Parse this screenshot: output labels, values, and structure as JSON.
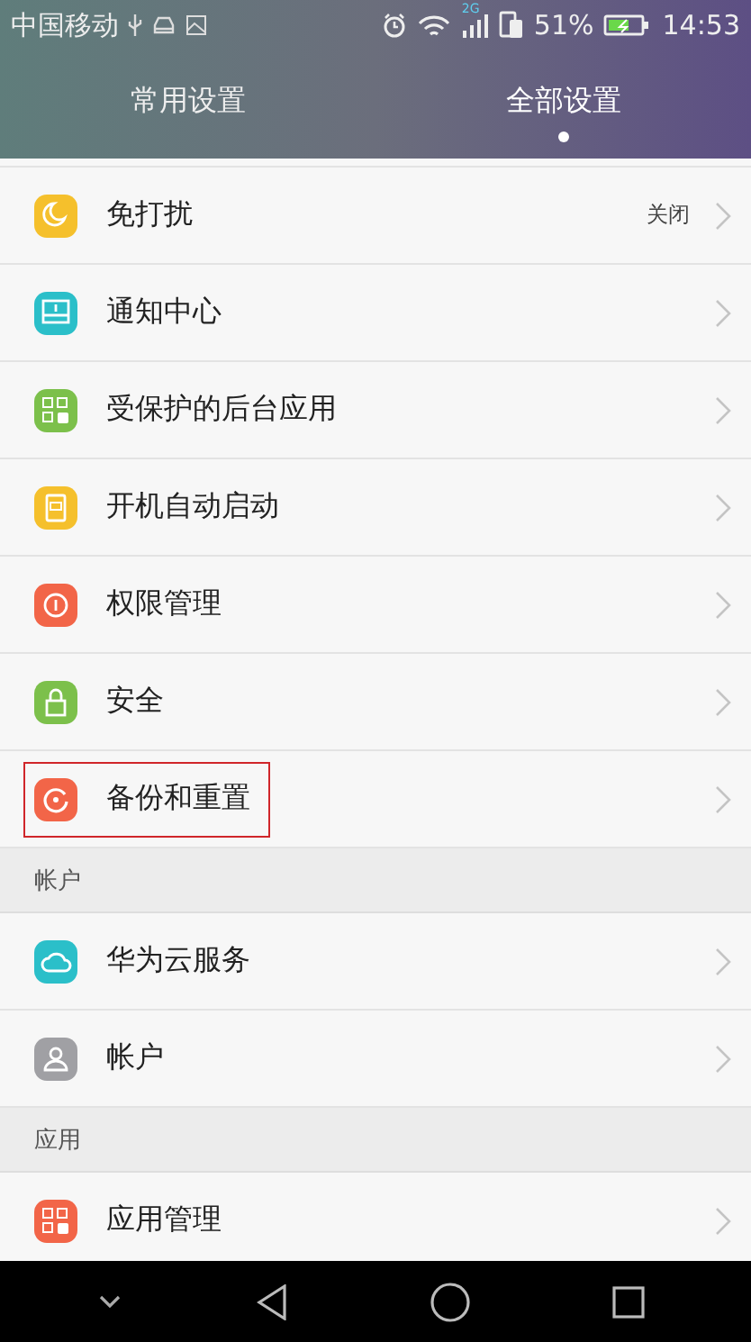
{
  "status_bar": {
    "carrier": "中国移动",
    "network_type": "2G",
    "battery_percent": "51%",
    "time": "14:53"
  },
  "tabs": [
    {
      "label": "常用设置",
      "selected": false
    },
    {
      "label": "全部设置",
      "selected": true
    }
  ],
  "sections": [
    {
      "items": [
        {
          "color": "#f5c02c",
          "label": "免打扰",
          "value": "关闭",
          "highlighted": false
        },
        {
          "color": "#2bbfc9",
          "label": "通知中心",
          "highlighted": false
        },
        {
          "color": "#7cc04b",
          "label": "受保护的后台应用",
          "highlighted": false
        },
        {
          "color": "#f5c02c",
          "label": "开机自动启动",
          "highlighted": false
        },
        {
          "color": "#f26548",
          "label": "权限管理",
          "highlighted": false
        },
        {
          "color": "#7cc04b",
          "label": "安全",
          "highlighted": false
        },
        {
          "color": "#f26548",
          "label": "备份和重置",
          "highlighted": true
        }
      ]
    },
    {
      "header": "帐户",
      "items": [
        {
          "color": "#2bbfc9",
          "label": "华为云服务",
          "highlighted": false
        },
        {
          "color": "#a0a0a4",
          "label": "帐户",
          "highlighted": false
        }
      ]
    },
    {
      "header": "应用",
      "items": [
        {
          "color": "#f26548",
          "label": "应用管理",
          "highlighted": false
        }
      ]
    }
  ]
}
